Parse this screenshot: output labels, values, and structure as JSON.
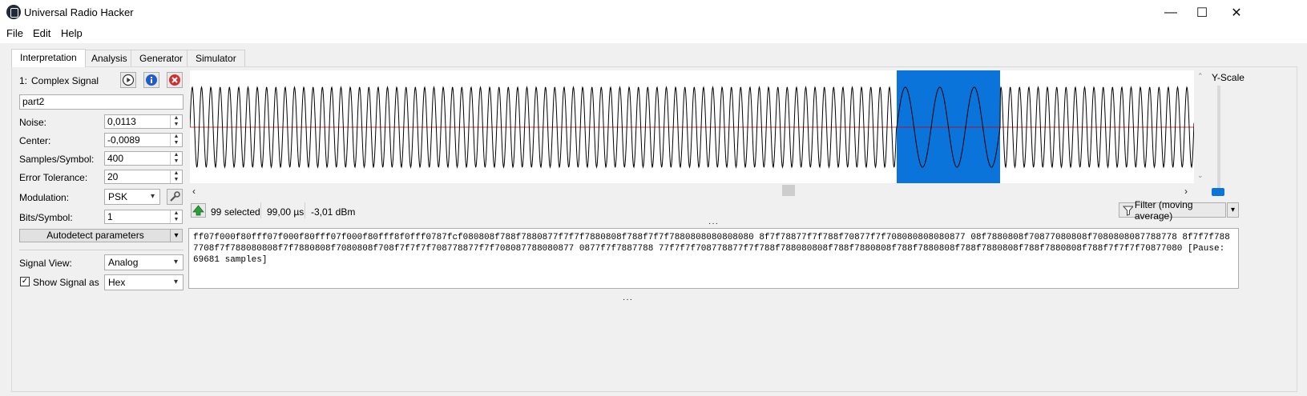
{
  "window": {
    "title": "Universal Radio Hacker",
    "minimize": "—",
    "maximize": "☐",
    "close": "✕"
  },
  "menu": [
    "File",
    "Edit",
    "Help"
  ],
  "tabs": [
    "Interpretation",
    "Analysis",
    "Generator",
    "Simulator"
  ],
  "signal": {
    "index": "1:",
    "name": "Complex Signal",
    "part_name": "part2",
    "fields": {
      "noise": {
        "label": "Noise:",
        "value": "0,0113"
      },
      "center": {
        "label": "Center:",
        "value": "-0,0089"
      },
      "samples_per_symbol": {
        "label": "Samples/Symbol:",
        "value": "400"
      },
      "error_tolerance": {
        "label": "Error Tolerance:",
        "value": "20"
      },
      "modulation": {
        "label": "Modulation:",
        "value": "PSK"
      },
      "bits_per_symbol": {
        "label": "Bits/Symbol:",
        "value": "1"
      }
    },
    "autodetect_label": "Autodetect parameters",
    "signal_view": {
      "label": "Signal View:",
      "value": "Analog"
    },
    "show_signal_as": {
      "label": "Show Signal as",
      "value": "Hex",
      "checked": true
    }
  },
  "plot": {
    "y_scale_label": "Y-Scale"
  },
  "status": {
    "selected_count": "99",
    "selected_label": "selected",
    "duration": "99,00 µs",
    "power": "-3,01 dBm",
    "filter_label": "Filter (moving average)"
  },
  "hex_output": "ff07f000f80fff07f000f80fff07f000f80fff8f0fff0787fcf080808f788f7880877f7f7f7880808f788f7f7f7880808080808080 8f7f78877f7f788f70877f7f708080808080877 08f7880808f70877080808f7080808087788778 8f7f7f7887708f7f788080808f7f7880808f7080808f708f7f7f7f708778877f7f708087788080877 0877f7f7887788 77f7f7f708778877f7f788f788080808f788f7880808f788f7880808f788f7880808f788f7880808f788f7f7f7f70877080 [Pause: 69681 samples]",
  "colors": {
    "selection": "#0a74da",
    "center_line": "#d00000",
    "waveform": "#000000"
  }
}
